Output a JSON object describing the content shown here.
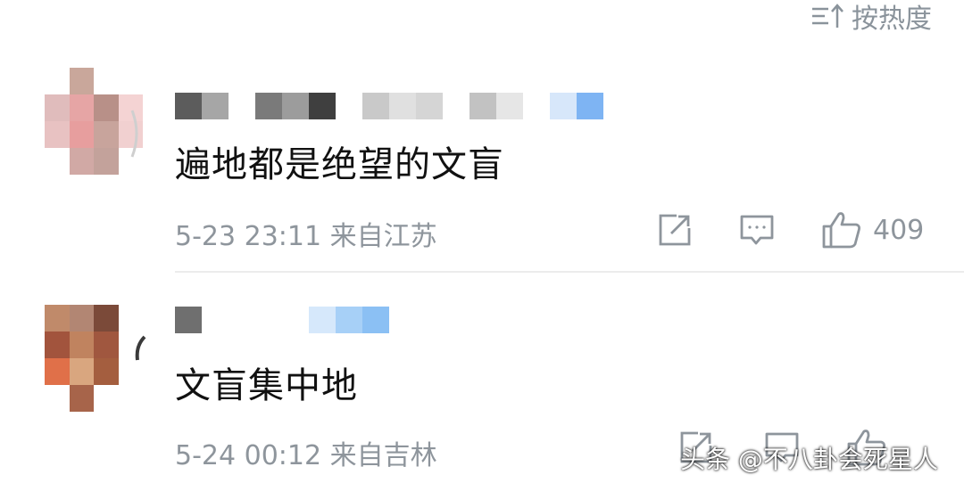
{
  "sort": {
    "label": "按热度",
    "icon": "sort-desc-icon"
  },
  "comments": [
    {
      "text": "遍地都是绝望的文盲",
      "meta": "5-23 23:11 来自江苏",
      "likes": "409",
      "avatar_colors": [
        "#ffffff",
        "#c9a79b",
        "#ffffff",
        "#ffffff",
        "#e0bcbc",
        "#e6a5a5",
        "#b89088",
        "#f4d3d3",
        "#e8c2c2",
        "#e79e9e",
        "#c8a49c",
        "#f1d0d0",
        "#ffffff",
        "#d1a9a5",
        "#c3a29b",
        "#ffffff"
      ],
      "name_colors": [
        "#5c5c5c",
        "#a6a6a6",
        "#ffffff",
        "#7a7a7a",
        "#9c9c9c",
        "#3f3f3f",
        "#ffffff",
        "#c9c9c9",
        "#e0e0e0",
        "#d5d5d5",
        "#ffffff",
        "#c2c2c2",
        "#e6e6e6",
        "#ffffff",
        "#d7e7fa",
        "#7eb4f3"
      ]
    },
    {
      "text": "文盲集中地",
      "meta": "5-24 00:12 来自吉林",
      "avatar_colors": [
        "#c08a6a",
        "#b28673",
        "#7b4a39",
        "#ffffff",
        "#a2543d",
        "#c0835f",
        "#a0573f",
        "#ffffff",
        "#e07049",
        "#d9a67f",
        "#a45e3f",
        "#ffffff",
        "#ffffff",
        "#a7644a",
        "#ffffff",
        "#ffffff"
      ],
      "name_colors": [
        "#6f6f6f",
        "#ffffff",
        "#ffffff",
        "#ffffff",
        "#ffffff",
        "#d6e8fb",
        "#a7d0f7",
        "#8bc0f4"
      ]
    }
  ],
  "watermark": "头条 @不八卦会死星人",
  "icons": {
    "share": "share-icon",
    "reply": "comment-icon",
    "like": "thumbs-up-icon"
  }
}
